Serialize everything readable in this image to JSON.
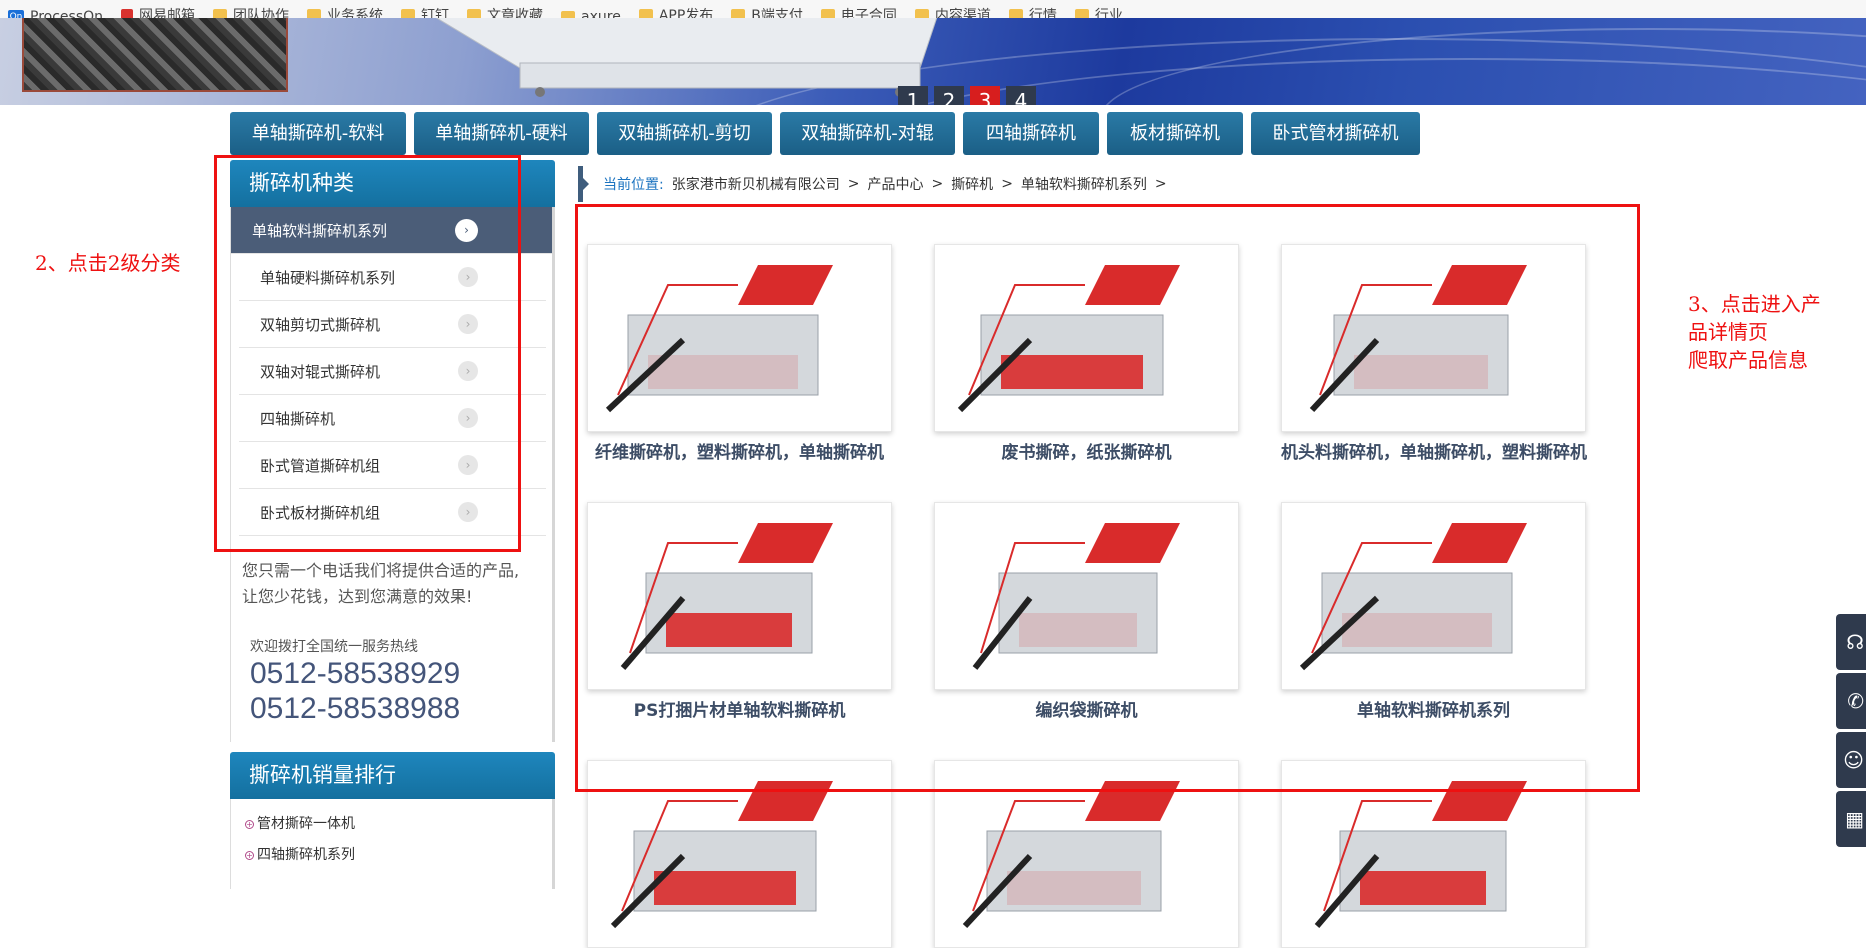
{
  "bookmarks": [
    {
      "label": "ProcessOn",
      "icon": "processon-icon"
    },
    {
      "label": "网易邮箱",
      "icon": "netease-icon"
    },
    {
      "label": "团队协作",
      "icon": "folder-icon"
    },
    {
      "label": "业务系统",
      "icon": "folder-icon"
    },
    {
      "label": "钉钉",
      "icon": "folder-icon"
    },
    {
      "label": "文章收藏",
      "icon": "folder-icon"
    },
    {
      "label": "axure",
      "icon": "folder-icon"
    },
    {
      "label": "APP发布",
      "icon": "folder-icon"
    },
    {
      "label": "B端支付",
      "icon": "folder-icon"
    },
    {
      "label": "电子合同",
      "icon": "folder-icon"
    },
    {
      "label": "内容渠道",
      "icon": "folder-icon"
    },
    {
      "label": "行情",
      "icon": "folder-icon"
    },
    {
      "label": "行业",
      "icon": "folder-icon"
    }
  ],
  "slider": {
    "pages": [
      "1",
      "2",
      "3",
      "4"
    ],
    "active_index": 2
  },
  "category_nav": [
    "单轴撕碎机-软料",
    "单轴撕碎机-硬料",
    "双轴撕碎机-剪切",
    "双轴撕碎机-对辊",
    "四轴撕碎机",
    "板材撕碎机",
    "卧式管材撕碎机"
  ],
  "sidebar": {
    "title": "撕碎机种类",
    "items": [
      "单轴软料撕碎机系列",
      "单轴硬料撕碎机系列",
      "双轴剪切式撕碎机",
      "双轴对辊式撕碎机",
      "四轴撕碎机",
      "卧式管道撕碎机组",
      "卧式板材撕碎机组"
    ],
    "active_index": 0,
    "promo_line1": "您只需一个电话我们将提供合适的产品,",
    "promo_line2": "让您少花钱，达到您满意的效果!",
    "hotline_label": "欢迎拨打全国统一服务热线",
    "phone1": "0512-58538929",
    "phone2": "0512-58538988",
    "rank_title": "撕碎机销量排行",
    "rank_items": [
      "管材撕碎一体机",
      "四轴撕碎机系列"
    ]
  },
  "breadcrumb": {
    "here_label": "当前位置:",
    "path": [
      "张家港市新贝机械有限公司",
      "产品中心",
      "撕碎机",
      "单轴软料撕碎机系列"
    ],
    "sep": ">"
  },
  "products": [
    "纤维撕碎机，塑料撕碎机，单轴撕碎机",
    "废书撕碎，纸张撕碎机",
    "机头料撕碎机，单轴撕碎机，塑料撕碎机",
    "PS打捆片材单轴软料撕碎机",
    "编织袋撕碎机",
    "单轴软料撕碎机系列",
    "",
    "",
    ""
  ],
  "annotations": {
    "step2": "2、点击2级分类",
    "step3_line1": "3、点击进入产",
    "step3_line2": "品详情页",
    "step3_line3": "爬取产品信息"
  },
  "colors": {
    "accent_red": "#ee1111",
    "nav_blue": "#1b5f86",
    "active_dot": "#d71e1e"
  },
  "float_tools": [
    "headset-icon",
    "phone-icon",
    "wechat-icon",
    "qrcode-icon"
  ]
}
